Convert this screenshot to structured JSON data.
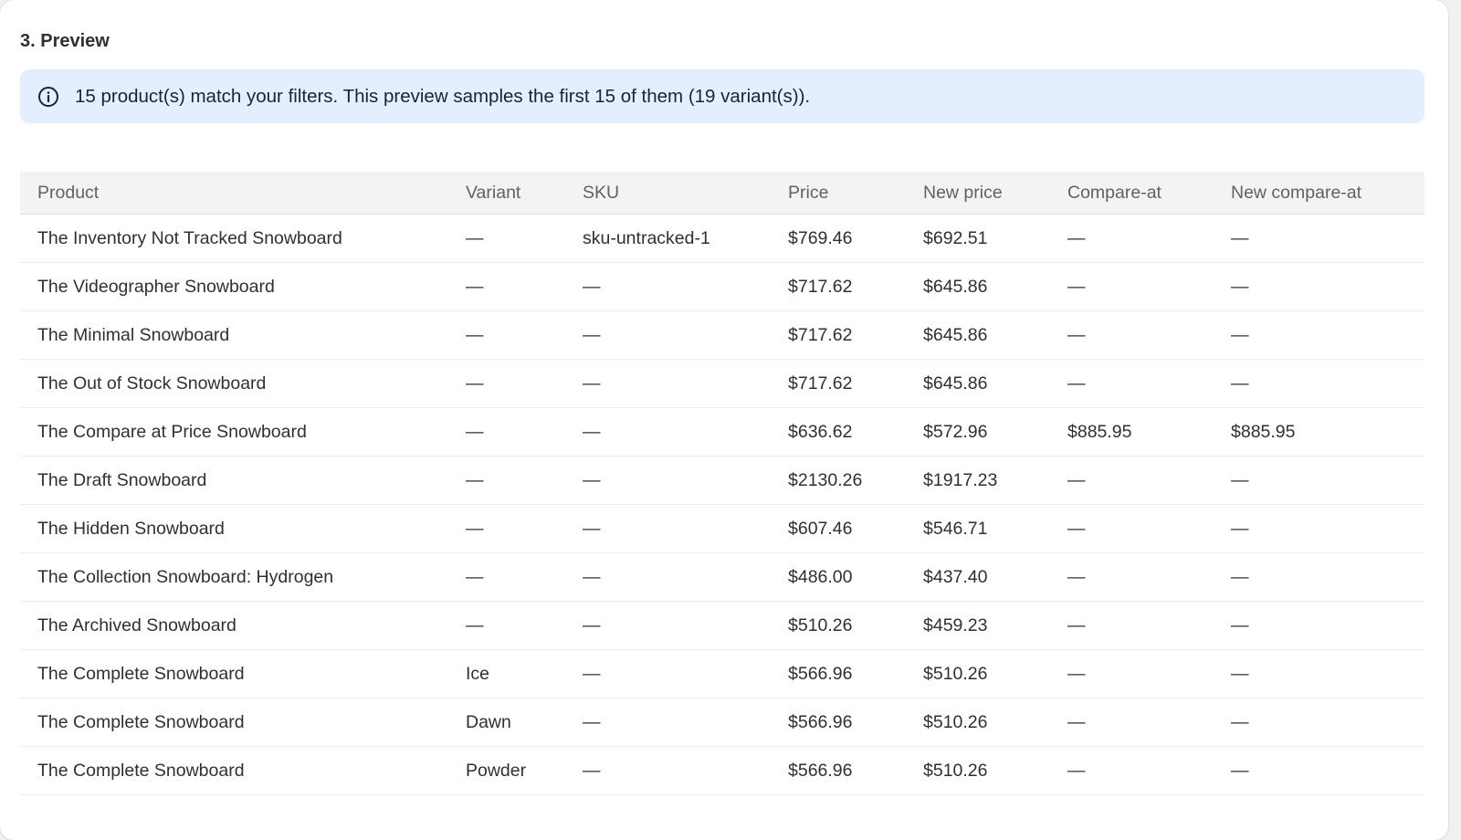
{
  "section": {
    "title": "3. Preview"
  },
  "banner": {
    "icon": "info-icon",
    "text": "15 product(s) match your filters. This preview samples the first 15 of them (19 variant(s))."
  },
  "table": {
    "columns": [
      "Product",
      "Variant",
      "SKU",
      "Price",
      "New price",
      "Compare-at",
      "New compare-at"
    ],
    "rows": [
      [
        "The Inventory Not Tracked Snowboard",
        "—",
        "sku-untracked-1",
        "$769.46",
        "$692.51",
        "—",
        "—"
      ],
      [
        "The Videographer Snowboard",
        "—",
        "—",
        "$717.62",
        "$645.86",
        "—",
        "—"
      ],
      [
        "The Minimal Snowboard",
        "—",
        "—",
        "$717.62",
        "$645.86",
        "—",
        "—"
      ],
      [
        "The Out of Stock Snowboard",
        "—",
        "—",
        "$717.62",
        "$645.86",
        "—",
        "—"
      ],
      [
        "The Compare at Price Snowboard",
        "—",
        "—",
        "$636.62",
        "$572.96",
        "$885.95",
        "$885.95"
      ],
      [
        "The Draft Snowboard",
        "—",
        "—",
        "$2130.26",
        "$1917.23",
        "—",
        "—"
      ],
      [
        "The Hidden Snowboard",
        "—",
        "—",
        "$607.46",
        "$546.71",
        "—",
        "—"
      ],
      [
        "The Collection Snowboard: Hydrogen",
        "—",
        "—",
        "$486.00",
        "$437.40",
        "—",
        "—"
      ],
      [
        "The Archived Snowboard",
        "—",
        "—",
        "$510.26",
        "$459.23",
        "—",
        "—"
      ],
      [
        "The Complete Snowboard",
        "Ice",
        "—",
        "$566.96",
        "$510.26",
        "—",
        "—"
      ],
      [
        "The Complete Snowboard",
        "Dawn",
        "—",
        "$566.96",
        "$510.26",
        "—",
        "—"
      ],
      [
        "The Complete Snowboard",
        "Powder",
        "—",
        "$566.96",
        "$510.26",
        "—",
        "—"
      ],
      [
        "",
        "",
        "",
        "",
        "",
        "",
        ""
      ]
    ]
  },
  "colors": {
    "banner_bg": "#e3effe",
    "header_bg": "#f3f3f3",
    "text": "#303030",
    "muted": "#616161",
    "icon": "#1a2433"
  }
}
